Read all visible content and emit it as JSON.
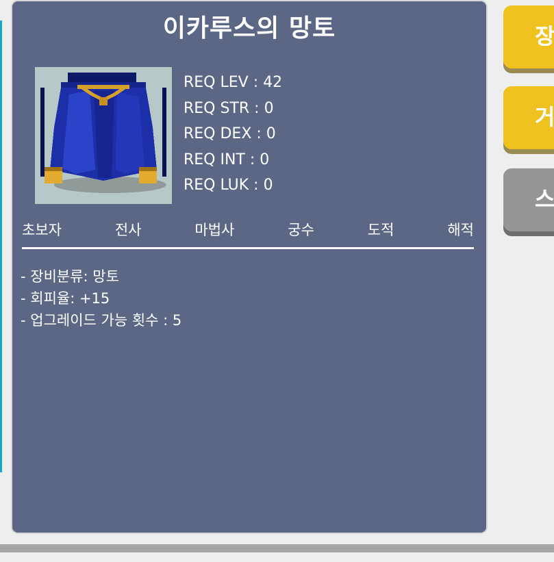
{
  "item": {
    "title": "이카루스의 망토",
    "image_icon": "blue-cape-icon",
    "requirements": [
      "REQ LEV : 42",
      "REQ STR : 0",
      "REQ DEX : 0",
      "REQ INT : 0",
      "REQ LUK : 0"
    ],
    "jobs": [
      "초보자",
      "전사",
      "마법사",
      "궁수",
      "도적",
      "해적"
    ],
    "description": [
      "- 장비분류: 망토",
      "- 회피율: +15",
      "- 업그레이드 가능 횟수 : 5"
    ]
  },
  "side_buttons": [
    {
      "label": "장",
      "color": "#f0c21f"
    },
    {
      "label": "거",
      "color": "#f0c21f"
    },
    {
      "label": "스",
      "color": "#969696"
    }
  ],
  "colors": {
    "panel": "#5b6785",
    "accent_yellow": "#f0c21f",
    "accent_gray": "#969696"
  }
}
